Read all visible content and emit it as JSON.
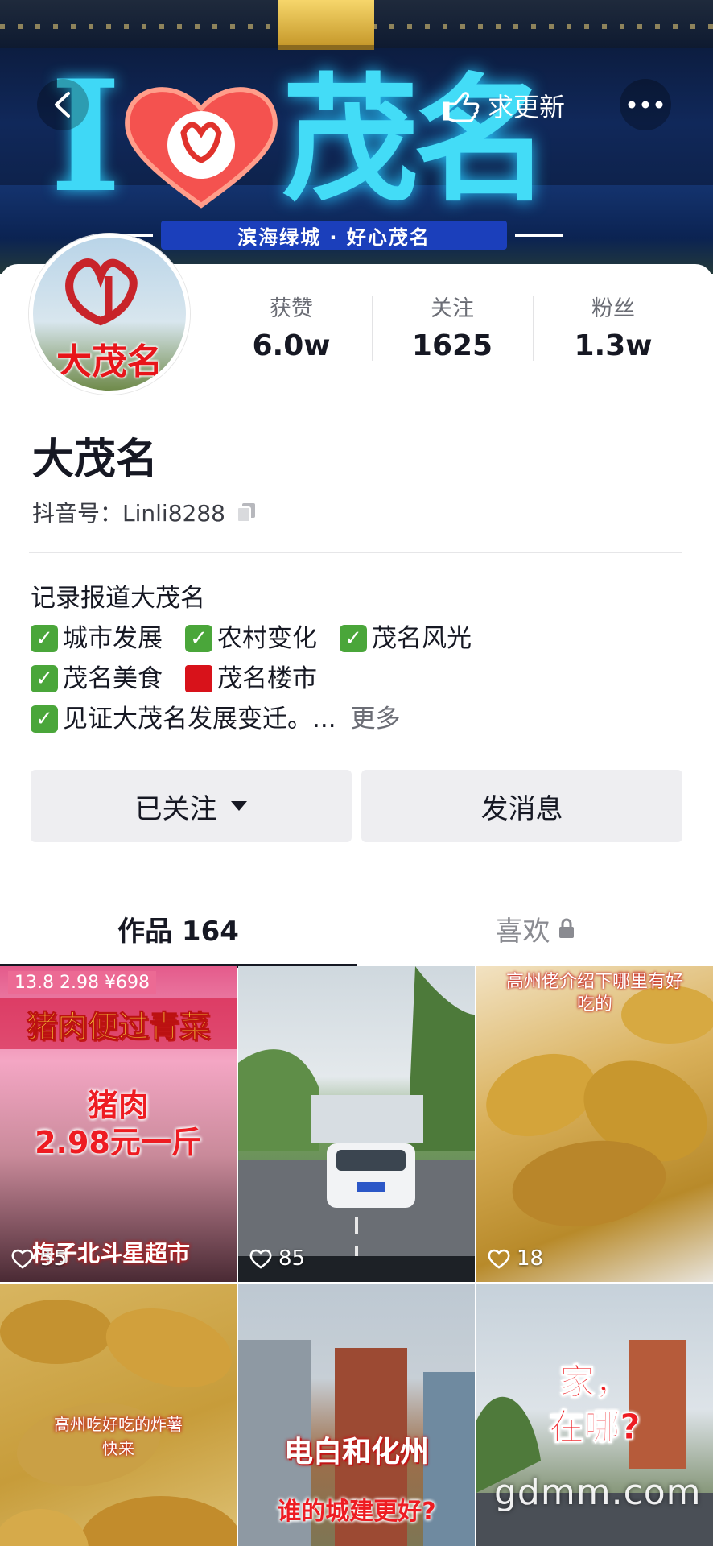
{
  "cover": {
    "sign_letter": "I",
    "sign_city": "茂名",
    "sign_slogan": "滨海绿城 · 好心茂名"
  },
  "header": {
    "refresh_label": "求更新"
  },
  "profile": {
    "avatar_text": "大茂名",
    "name": "大茂名",
    "account_label": "抖音号：",
    "account_id": "Linli8288",
    "stats": [
      {
        "label": "获赞",
        "value": "6.0w"
      },
      {
        "label": "关注",
        "value": "1625"
      },
      {
        "label": "粉丝",
        "value": "1.3w"
      }
    ],
    "bio": {
      "line1": "记录报道大茂名",
      "tags_row1": [
        "城市发展",
        "农村变化",
        "茂名风光"
      ],
      "tags_row2_a": "茂名美食",
      "tags_row2_b": "茂名楼市",
      "line4": "见证大茂名发展变迁。...",
      "more": "更多"
    }
  },
  "actions": {
    "follow_label": "已关注",
    "message_label": "发消息"
  },
  "tabs": {
    "works_label": "作品 164",
    "likes_label": "喜欢"
  },
  "videos": [
    {
      "caption_top": "猪肉便过青菜",
      "caption_mid": "猪肉\n2.98元一斤",
      "caption_bottom": "梅子北斗星超市",
      "price_tag": "13.8  2.98  ¥698",
      "likes": "55"
    },
    {
      "likes": "85"
    },
    {
      "caption_top": "高州佬介绍下哪里有好吃的",
      "likes": "18"
    },
    {
      "caption_mid": "高州吃好吃的炸薯\n快来"
    },
    {
      "caption_mid": "电白和化州",
      "caption_bottom": "谁的城建更好?"
    },
    {
      "caption_mid": "家，\n在哪?"
    }
  ],
  "watermark": "gdmm.com",
  "colors": {
    "sign_cyan": "#43dcf7",
    "heart_red": "#f4524f",
    "check_green": "#4aa63a",
    "square_red": "#d8121a",
    "button_bg": "#eeeef1"
  }
}
